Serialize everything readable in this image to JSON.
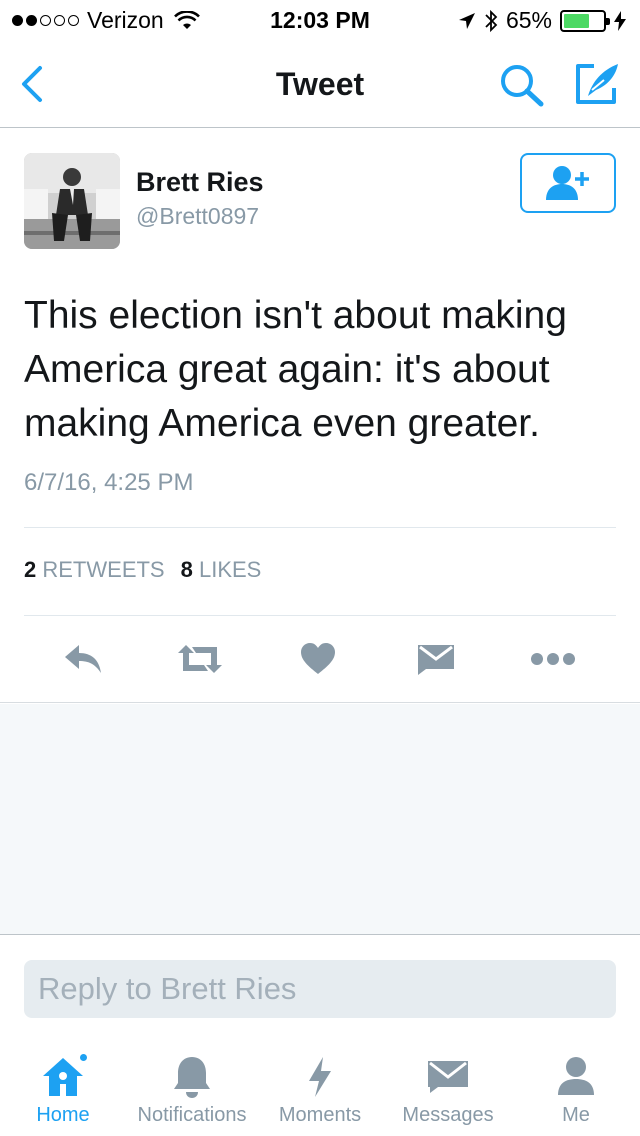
{
  "status_bar": {
    "carrier": "Verizon",
    "time": "12:03 PM",
    "battery_percent": "65%",
    "battery_level": 0.65,
    "battery_color": "#4cd964"
  },
  "nav": {
    "title": "Tweet",
    "icons": [
      "chevron-left-icon",
      "search-icon",
      "compose-icon"
    ],
    "accent_color": "#1da1f2"
  },
  "tweet": {
    "author_name": "Brett Ries",
    "author_handle": "@Brett0897",
    "text": "This election isn't about making America great again: it's about making America even greater.",
    "timestamp": "6/7/16, 4:25 PM",
    "retweet_count": "2",
    "retweet_label": "RETWEETS",
    "like_count": "8",
    "like_label": "LIKES",
    "actions": [
      "reply-icon",
      "retweet-icon",
      "like-icon",
      "dm-icon",
      "more-icon"
    ]
  },
  "reply": {
    "placeholder": "Reply to Brett Ries"
  },
  "tab_bar": {
    "tabs": [
      {
        "label": "Home",
        "icon": "home-icon",
        "active": true
      },
      {
        "label": "Notifications",
        "icon": "bell-icon",
        "active": false
      },
      {
        "label": "Moments",
        "icon": "lightning-icon",
        "active": false
      },
      {
        "label": "Messages",
        "icon": "envelope-icon",
        "active": false
      },
      {
        "label": "Me",
        "icon": "person-icon",
        "active": false
      }
    ]
  }
}
